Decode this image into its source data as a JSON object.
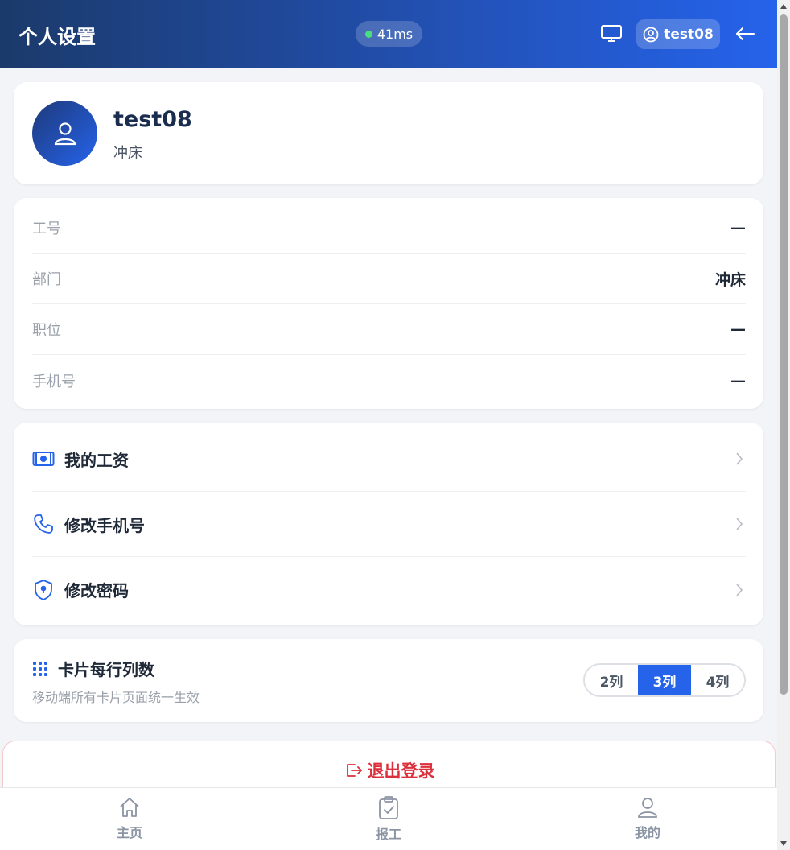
{
  "header": {
    "title": "个人设置",
    "latency": "41ms",
    "user": "test08",
    "icons": {
      "monitor": "monitor-icon",
      "user": "user-circle-icon",
      "back": "arrow-left-icon"
    }
  },
  "profile": {
    "name": "test08",
    "department": "冲床"
  },
  "info": {
    "rows": [
      {
        "label": "工号",
        "value": "—"
      },
      {
        "label": "部门",
        "value": "冲床"
      },
      {
        "label": "职位",
        "value": "—"
      },
      {
        "label": "手机号",
        "value": "—"
      }
    ]
  },
  "menu": {
    "items": [
      {
        "label": "我的工资",
        "icon": "cash-icon"
      },
      {
        "label": "修改手机号",
        "icon": "phone-icon"
      },
      {
        "label": "修改密码",
        "icon": "shield-lock-icon"
      }
    ]
  },
  "columns": {
    "title": "卡片每行列数",
    "subtitle": "移动端所有卡片页面统一生效",
    "options": [
      "2列",
      "3列",
      "4列"
    ],
    "selected": "3列"
  },
  "logout": {
    "label": "退出登录"
  },
  "nav": {
    "items": [
      {
        "label": "主页",
        "icon": "home-icon"
      },
      {
        "label": "报工",
        "icon": "clipboard-check-icon"
      },
      {
        "label": "我的",
        "icon": "user-icon"
      }
    ]
  },
  "colors": {
    "accent": "#2563eb",
    "header_start": "#1b3a6b",
    "danger": "#dc2f3c",
    "status_online": "#4ade80"
  }
}
